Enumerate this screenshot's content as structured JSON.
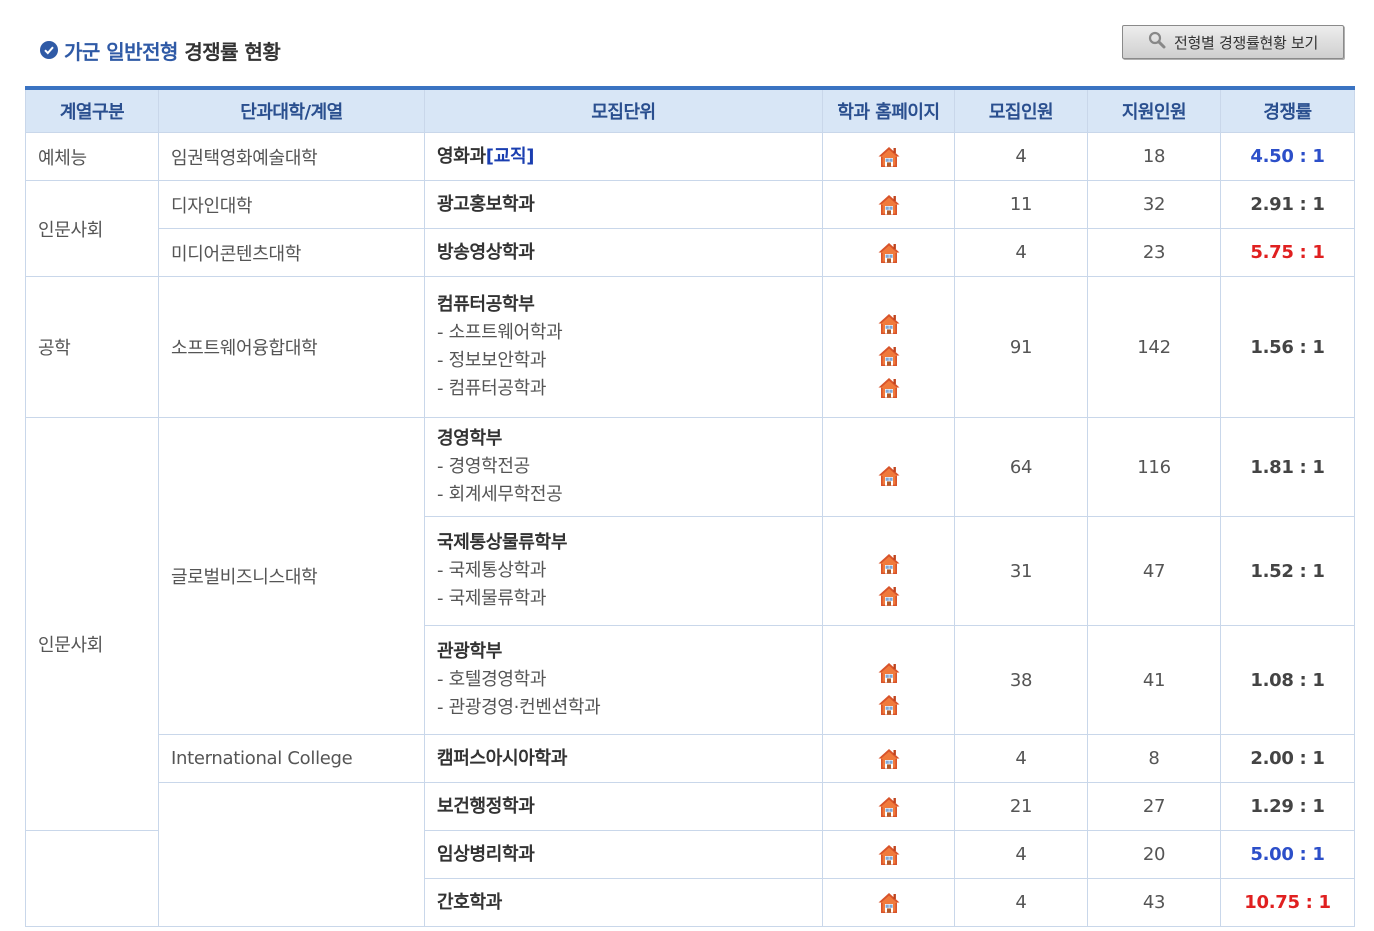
{
  "header": {
    "title_part1": "가군 일반전형",
    "title_part2": "경쟁률 현황",
    "view_button": "전형별 경쟁률현황 보기"
  },
  "columns": [
    "계열구분",
    "단과대학/계열",
    "모집단위",
    "학과 홈페이지",
    "모집인원",
    "지원인원",
    "경쟁률"
  ],
  "colors": {
    "accent": "#2f5aa6",
    "header_bg": "#d8e6f6",
    "high_rate": "#e02020",
    "low_rate": "#2c4fc9",
    "normal_rate": "#444444"
  },
  "rows": [
    {
      "category": "예체능",
      "college": "임권택영화예술대학",
      "unit": "영화과",
      "unit_tag": "[교직]",
      "subs": [],
      "homes": 1,
      "quota": "4",
      "applicants": "18",
      "rate": "4.50 : 1",
      "rate_color": "#2c4fc9"
    },
    {
      "category": "인문사회",
      "college": "디자인대학",
      "unit": "광고홍보학과",
      "unit_tag": "",
      "subs": [],
      "homes": 1,
      "quota": "11",
      "applicants": "32",
      "rate": "2.91 : 1",
      "rate_color": "#444444"
    },
    {
      "category": "",
      "college": "미디어콘텐츠대학",
      "unit": "방송영상학과",
      "unit_tag": "",
      "subs": [],
      "homes": 1,
      "quota": "4",
      "applicants": "23",
      "rate": "5.75 : 1",
      "rate_color": "#e02020"
    },
    {
      "category": "공학",
      "college": "소프트웨어융합대학",
      "unit": "컴퓨터공학부",
      "unit_tag": "",
      "subs": [
        "- 소프트웨어학과",
        "- 정보보안학과",
        "- 컴퓨터공학과"
      ],
      "homes": 3,
      "quota": "91",
      "applicants": "142",
      "rate": "1.56 : 1",
      "rate_color": "#444444"
    },
    {
      "category": "인문사회",
      "college": "글로벌비즈니스대학",
      "unit": "경영학부",
      "unit_tag": "",
      "subs": [
        "- 경영학전공",
        "- 회계세무학전공"
      ],
      "homes": 1,
      "quota": "64",
      "applicants": "116",
      "rate": "1.81 : 1",
      "rate_color": "#444444"
    },
    {
      "category": "",
      "college": "",
      "unit": "국제통상물류학부",
      "unit_tag": "",
      "subs": [
        "- 국제통상학과",
        "- 국제물류학과"
      ],
      "homes": 2,
      "quota": "31",
      "applicants": "47",
      "rate": "1.52 : 1",
      "rate_color": "#444444"
    },
    {
      "category": "",
      "college": "",
      "unit": "관광학부",
      "unit_tag": "",
      "subs": [
        "- 호텔경영학과",
        "- 관광경영·컨벤션학과"
      ],
      "homes": 2,
      "quota": "38",
      "applicants": "41",
      "rate": "1.08 : 1",
      "rate_color": "#444444"
    },
    {
      "category": "",
      "college": "International College",
      "unit": "캠퍼스아시아학과",
      "unit_tag": "",
      "subs": [],
      "homes": 1,
      "quota": "4",
      "applicants": "8",
      "rate": "2.00 : 1",
      "rate_color": "#444444"
    },
    {
      "category": "",
      "college": "",
      "unit": "보건행정학과",
      "unit_tag": "",
      "subs": [],
      "homes": 1,
      "quota": "21",
      "applicants": "27",
      "rate": "1.29 : 1",
      "rate_color": "#444444"
    },
    {
      "category": "",
      "college": "",
      "unit": "임상병리학과",
      "unit_tag": "",
      "subs": [],
      "homes": 1,
      "quota": "4",
      "applicants": "20",
      "rate": "5.00 : 1",
      "rate_color": "#2c4fc9"
    },
    {
      "category": "",
      "college": "",
      "unit": "간호학과",
      "unit_tag": "",
      "subs": [],
      "homes": 1,
      "quota": "4",
      "applicants": "43",
      "rate": "10.75 : 1",
      "rate_color": "#e02020"
    }
  ]
}
